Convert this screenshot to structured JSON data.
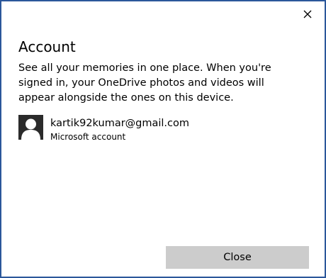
{
  "dialog": {
    "title": "Account",
    "description": "See all your memories in one place. When you're signed in, your OneDrive photos and videos will appear alongside the ones on this device.",
    "close_icon": "close-icon",
    "border_color": "#2b579a"
  },
  "account": {
    "avatar_icon": "person-avatar-icon",
    "email": "kartik92kumar@gmail.com",
    "type": "Microsoft account"
  },
  "footer": {
    "close_label": "Close",
    "button_color": "#cccccc"
  }
}
